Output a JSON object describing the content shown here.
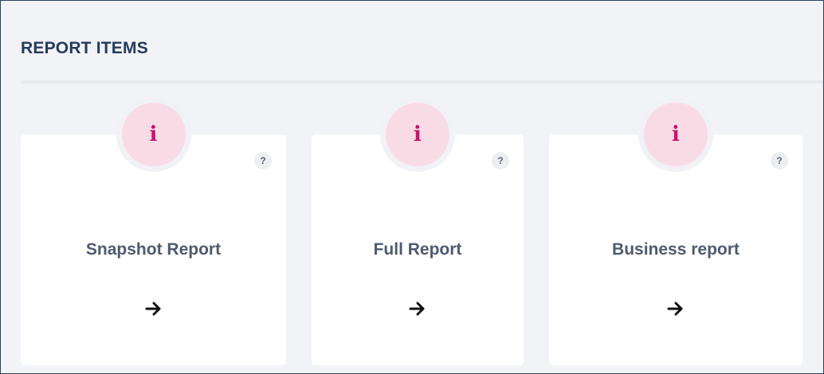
{
  "section": {
    "title": "REPORT ITEMS"
  },
  "cards": [
    {
      "title": "Snapshot Report",
      "info_icon": "info-icon",
      "help_label": "?",
      "arrow_icon": "arrow-right-icon"
    },
    {
      "title": "Full Report",
      "info_icon": "info-icon",
      "help_label": "?",
      "arrow_icon": "arrow-right-icon"
    },
    {
      "title": "Business report",
      "info_icon": "info-icon",
      "help_label": "?",
      "arrow_icon": "arrow-right-icon"
    }
  ],
  "info_glyph": "i",
  "colors": {
    "title": "#253a5e",
    "card_title": "#4f5a6f",
    "info_badge_bg": "#f9dbe6",
    "info_glyph": "#c8146a",
    "background": "#f2f3f6"
  }
}
